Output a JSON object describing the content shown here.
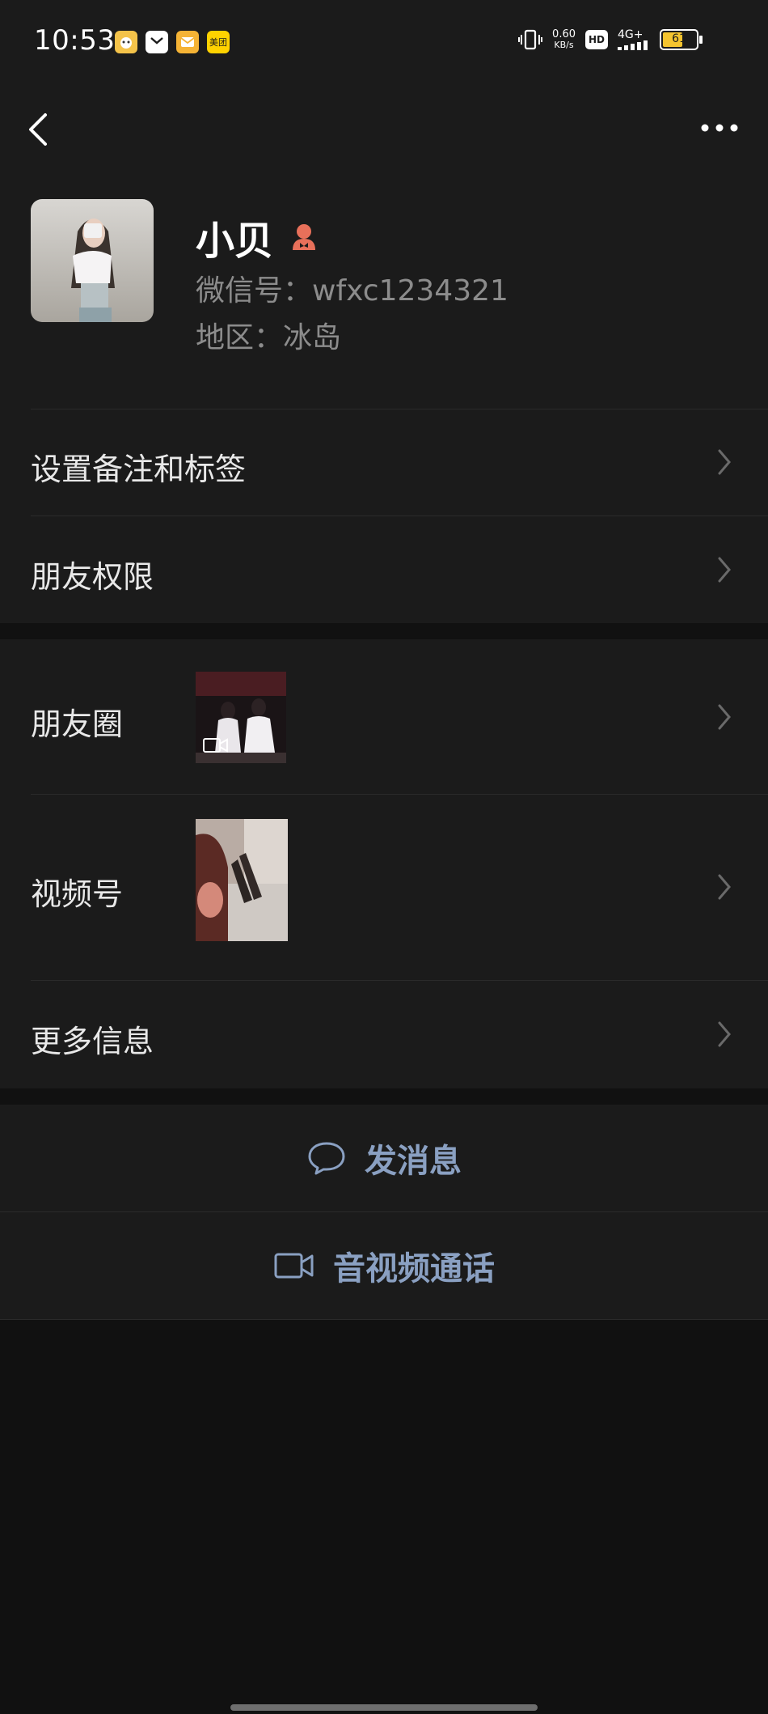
{
  "status_bar": {
    "time": "10:53",
    "net_speed_value": "0.60",
    "net_speed_unit": "KB/s",
    "hd_label": "HD",
    "signal_label": "4G+",
    "battery_level": "61",
    "app_icons": [
      "pet-app-icon",
      "message-app-icon",
      "mail-app-icon",
      "meituan-app-icon"
    ],
    "meituan_label": "美团"
  },
  "nav": {
    "back_icon": "chevron-left-icon",
    "more_icon": "more-dots-icon"
  },
  "profile": {
    "name": "小贝",
    "gender_icon": "female-gender-icon",
    "wechat_id": "微信号：wfxc1234321",
    "region": "地区：冰岛"
  },
  "menu_group_1": [
    {
      "label": "设置备注和标签"
    },
    {
      "label": "朋友权限"
    }
  ],
  "menu_group_2": [
    {
      "label": "朋友圈"
    },
    {
      "label": "视频号"
    },
    {
      "label": "更多信息"
    }
  ],
  "actions": {
    "send_message": "发消息",
    "av_call": "音视频通话"
  },
  "colors": {
    "background": "#111111",
    "panel": "#1b1b1b",
    "action_text": "#8aa0c2",
    "gender_icon": "#e8705a",
    "secondary_text": "#8c8c8c"
  }
}
